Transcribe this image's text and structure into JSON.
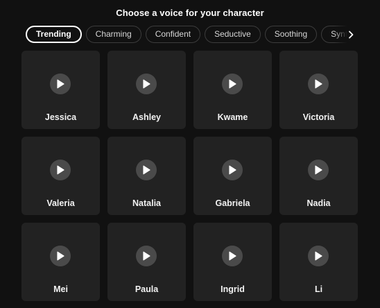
{
  "header": {
    "title": "Choose a voice for your character"
  },
  "tabs": [
    {
      "label": "Trending",
      "active": true
    },
    {
      "label": "Charming",
      "active": false
    },
    {
      "label": "Confident",
      "active": false
    },
    {
      "label": "Seductive",
      "active": false
    },
    {
      "label": "Soothing",
      "active": false
    },
    {
      "label": "Synthetic",
      "active": false
    }
  ],
  "icons": {
    "tabs_next": "chevron-right-icon",
    "play": "play-icon"
  },
  "voices": [
    {
      "name": "Jessica"
    },
    {
      "name": "Ashley"
    },
    {
      "name": "Kwame"
    },
    {
      "name": "Victoria"
    },
    {
      "name": "Valeria"
    },
    {
      "name": "Natalia"
    },
    {
      "name": "Gabriela"
    },
    {
      "name": "Nadia"
    },
    {
      "name": "Mei"
    },
    {
      "name": "Paula"
    },
    {
      "name": "Ingrid"
    },
    {
      "name": "Li"
    }
  ],
  "colors": {
    "background": "#111111",
    "card": "#222222",
    "play_button": "#4a4a4a",
    "text": "#ffffff"
  }
}
